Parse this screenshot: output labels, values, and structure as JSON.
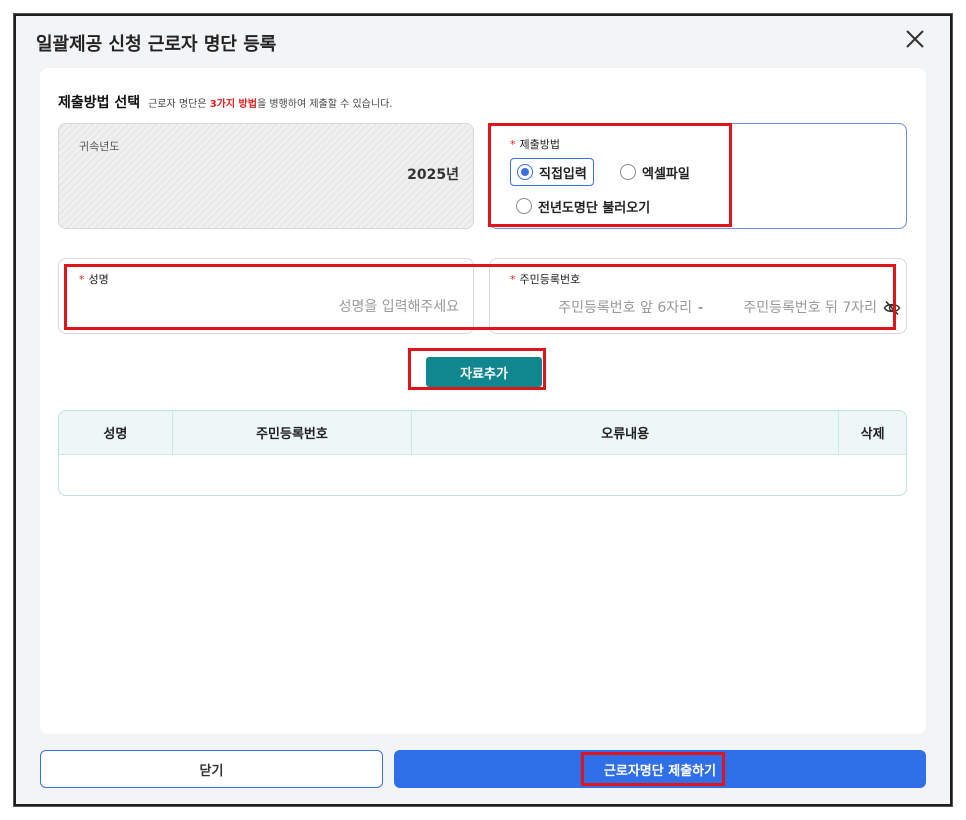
{
  "dialog": {
    "title": "일괄제공 신청 근로자 명단 등록",
    "close_icon": "close-icon"
  },
  "section": {
    "title": "제출방법 선택",
    "desc_prefix": "근로자 명단은 ",
    "desc_highlight": "3가지 방법",
    "desc_suffix": "을 병행하여 제출할 수 있습니다."
  },
  "year_field": {
    "label": "귀속년도",
    "value": "2025년"
  },
  "method_field": {
    "required_mark": "*",
    "label": "제출방법",
    "options": [
      {
        "label": "직접입력",
        "selected": true
      },
      {
        "label": "엑셀파일",
        "selected": false
      },
      {
        "label": "전년도명단 불러오기",
        "selected": false
      }
    ]
  },
  "name_field": {
    "required_mark": "*",
    "label": "성명",
    "value": "",
    "placeholder": "성명을 입력해주세요"
  },
  "rrn_field": {
    "required_mark": "*",
    "label": "주민등록번호",
    "front_placeholder": "주민등록번호 앞 6자리",
    "separator": "-",
    "back_placeholder": "주민등록번호 뒤 7자리",
    "visibility_icon": "eye-slash-icon"
  },
  "add_button": {
    "label": "자료추가"
  },
  "table": {
    "columns": [
      "성명",
      "주민등록번호",
      "오류내용",
      "삭제"
    ],
    "rows": []
  },
  "footer": {
    "close_label": "닫기",
    "submit_label": "근로자명단 제출하기"
  },
  "colors": {
    "accent_blue": "#2f6fe8",
    "teal_button": "#10868f",
    "highlight_red": "#e0151b",
    "required_red": "#e02020"
  }
}
